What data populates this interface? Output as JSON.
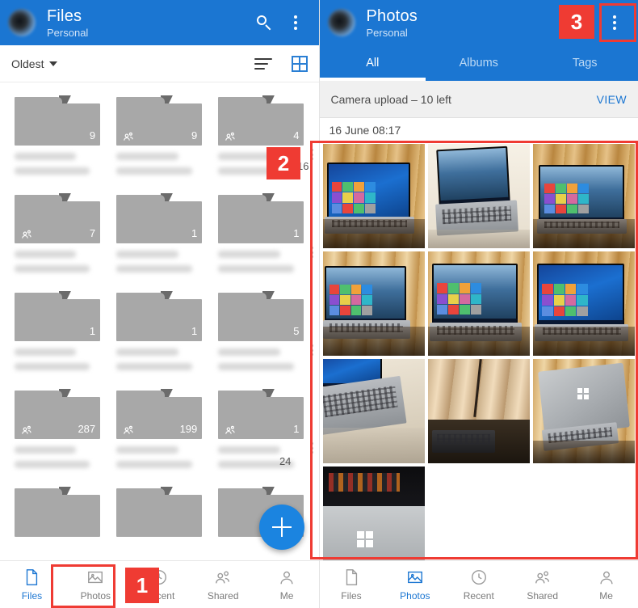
{
  "left_panel": {
    "appbar": {
      "title": "Files",
      "subtitle": "Personal",
      "search_icon": "search-icon",
      "overflow_icon": "more-vertical-icon"
    },
    "toolbar": {
      "sort_label": "Oldest",
      "list_view_icon": "list-view-icon",
      "grid_view_icon": "grid-view-icon"
    },
    "folders": [
      {
        "count": "9",
        "shared": false,
        "preview": "pv-mountain"
      },
      {
        "count": "9",
        "shared": true,
        "preview": "pv-red"
      },
      {
        "count": "4",
        "shared": true,
        "preview": "pv-white"
      },
      {
        "count": "7",
        "shared": true,
        "preview": "pv-white"
      },
      {
        "count": "1",
        "shared": false,
        "preview": "pv-black"
      },
      {
        "count": "1",
        "shared": false,
        "preview": "pv-gray"
      },
      {
        "count": "1",
        "shared": false,
        "preview": "pv-white"
      },
      {
        "count": "1",
        "shared": false,
        "preview": "pv-cyan"
      },
      {
        "count": "5",
        "shared": false,
        "preview": "pv-blue"
      },
      {
        "count": "287",
        "shared": true,
        "preview": "pv-white"
      },
      {
        "count": "199",
        "shared": true,
        "preview": "pv-white"
      },
      {
        "count": "1",
        "shared": true,
        "preview": "pv-white"
      },
      {
        "count": "",
        "shared": false,
        "preview": "pv-white"
      },
      {
        "count": "",
        "shared": false,
        "preview": "pv-dark"
      },
      {
        "count": "",
        "shared": false,
        "preview": "pv-white"
      }
    ],
    "partial_date_text": "2016",
    "partial_count_text": "24",
    "fab": {
      "icon": "plus-icon"
    },
    "bottom_nav": [
      {
        "label": "Files",
        "icon": "file-icon",
        "active": true
      },
      {
        "label": "Photos",
        "icon": "photo-icon",
        "active": false
      },
      {
        "label": "Recent",
        "icon": "clock-icon",
        "active": false
      },
      {
        "label": "Shared",
        "icon": "people-icon",
        "active": false
      },
      {
        "label": "Me",
        "icon": "person-icon",
        "active": false
      }
    ]
  },
  "right_panel": {
    "appbar": {
      "title": "Photos",
      "subtitle": "Personal",
      "search_icon": "search-icon",
      "overflow_icon": "more-vertical-icon"
    },
    "tabs": [
      {
        "label": "All",
        "active": true
      },
      {
        "label": "Albums",
        "active": false
      },
      {
        "label": "Tags",
        "active": false
      }
    ],
    "banner": {
      "text": "Camera upload – 10 left",
      "action": "VIEW"
    },
    "date_header": "16 June  08:17",
    "photos": [
      {
        "art": "p1"
      },
      {
        "art": "p2"
      },
      {
        "art": "p3"
      },
      {
        "art": "p4"
      },
      {
        "art": "p5"
      },
      {
        "art": "p6"
      },
      {
        "art": "p7"
      },
      {
        "art": "p8"
      },
      {
        "art": "p9"
      },
      {
        "art": "p10"
      }
    ],
    "bottom_nav": [
      {
        "label": "Files",
        "icon": "file-icon",
        "active": false
      },
      {
        "label": "Photos",
        "icon": "photo-icon",
        "active": true
      },
      {
        "label": "Recent",
        "icon": "clock-icon",
        "active": false
      },
      {
        "label": "Shared",
        "icon": "people-icon",
        "active": false
      },
      {
        "label": "Me",
        "icon": "person-icon",
        "active": false
      }
    ]
  },
  "annotations": {
    "accent_color": "#ef3b33",
    "badges": [
      {
        "label": "1"
      },
      {
        "label": "2"
      },
      {
        "label": "3"
      }
    ]
  },
  "theme": {
    "appbar_blue": "#1b76d2",
    "accent_blue": "#1b84e0",
    "banner_gray": "#f0f0f0"
  }
}
